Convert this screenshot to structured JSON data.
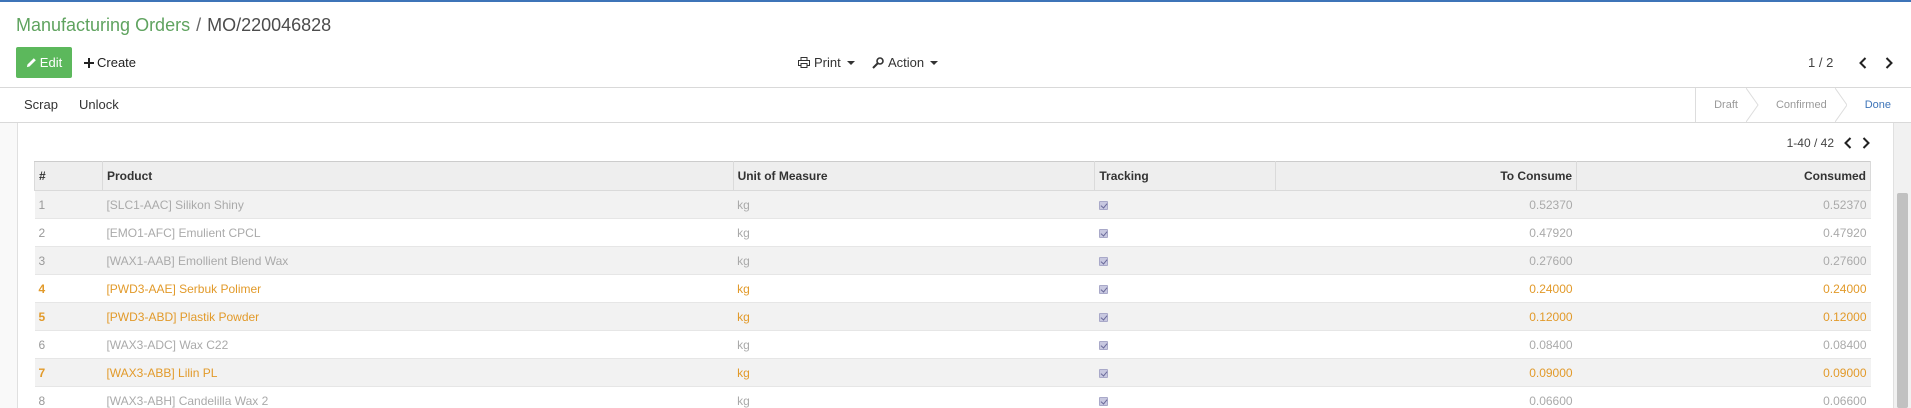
{
  "breadcrumb": {
    "parent": "Manufacturing Orders",
    "separator": "/",
    "current": "MO/220046828"
  },
  "toolbar": {
    "edit_label": "Edit",
    "create_label": "Create",
    "print_label": "Print",
    "action_label": "Action"
  },
  "pager": {
    "text": "1 / 2"
  },
  "statusbar": {
    "buttons": [
      "Scrap",
      "Unlock"
    ],
    "stages": [
      {
        "label": "Draft",
        "active": false
      },
      {
        "label": "Confirmed",
        "active": false
      },
      {
        "label": "Done",
        "active": true
      }
    ]
  },
  "list": {
    "pager_text": "1-40 / 42",
    "columns": [
      "#",
      "Product",
      "Unit of Measure",
      "Tracking",
      "To Consume",
      "Consumed"
    ],
    "rows": [
      {
        "idx": "1",
        "product": "[SLC1-AAC] Silikon Shiny",
        "uom": "kg",
        "tracking": true,
        "to_consume": "0.52370",
        "consumed": "0.52370",
        "style": "muted"
      },
      {
        "idx": "2",
        "product": "[EMO1-AFC] Emulient CPCL",
        "uom": "kg",
        "tracking": true,
        "to_consume": "0.47920",
        "consumed": "0.47920",
        "style": "muted"
      },
      {
        "idx": "3",
        "product": "[WAX1-AAB] Emollient Blend Wax",
        "uom": "kg",
        "tracking": true,
        "to_consume": "0.27600",
        "consumed": "0.27600",
        "style": "muted"
      },
      {
        "idx": "4",
        "product": "[PWD3-AAE] Serbuk Polimer",
        "uom": "kg",
        "tracking": true,
        "to_consume": "0.24000",
        "consumed": "0.24000",
        "style": "warn"
      },
      {
        "idx": "5",
        "product": "[PWD3-ABD] Plastik Powder",
        "uom": "kg",
        "tracking": true,
        "to_consume": "0.12000",
        "consumed": "0.12000",
        "style": "warn"
      },
      {
        "idx": "6",
        "product": "[WAX3-ADC] Wax C22",
        "uom": "kg",
        "tracking": true,
        "to_consume": "0.08400",
        "consumed": "0.08400",
        "style": "muted"
      },
      {
        "idx": "7",
        "product": "[WAX3-ABB] Lilin PL",
        "uom": "kg",
        "tracking": true,
        "to_consume": "0.09000",
        "consumed": "0.09000",
        "style": "warn"
      },
      {
        "idx": "8",
        "product": "[WAX3-ABH] Candelilla Wax 2",
        "uom": "kg",
        "tracking": true,
        "to_consume": "0.06600",
        "consumed": "0.06600",
        "style": "muted"
      }
    ]
  },
  "colors": {
    "accent": "#5fa35f",
    "edit_button": "#5cb85c",
    "warning_row": "#e29a2a",
    "active_stage": "#3d74b8"
  },
  "icons": {
    "edit": "pencil-icon",
    "create": "plus-icon",
    "print": "printer-icon",
    "action": "wrench-icon",
    "prev": "chevron-left-icon",
    "next": "chevron-right-icon"
  }
}
